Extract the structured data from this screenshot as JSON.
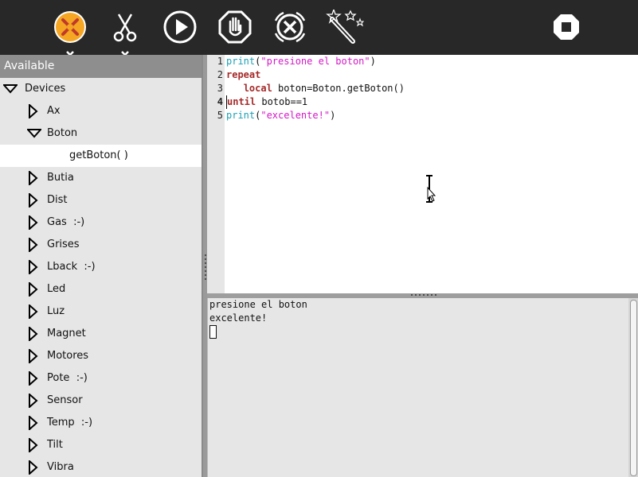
{
  "toolbar": {
    "buttons": [
      {
        "name": "activity-icon"
      },
      {
        "name": "scissors-icon"
      },
      {
        "name": "play-icon"
      },
      {
        "name": "stop-hand-icon"
      },
      {
        "name": "cancel-icon"
      },
      {
        "name": "magic-wand-icon"
      },
      {
        "name": "stop-icon"
      }
    ]
  },
  "sidebar": {
    "header": "Available",
    "items": [
      {
        "label": "Devices",
        "state": "expanded",
        "level": 0
      },
      {
        "label": "Ax",
        "state": "collapsed",
        "level": 1
      },
      {
        "label": "Boton",
        "state": "expanded",
        "level": 1
      },
      {
        "label": "getBoton( )",
        "state": "leaf",
        "level": 2,
        "selected": true
      },
      {
        "label": "Butia",
        "state": "collapsed",
        "level": 1
      },
      {
        "label": "Dist",
        "state": "collapsed",
        "level": 1
      },
      {
        "label": "Gas  :-)",
        "state": "collapsed",
        "level": 1
      },
      {
        "label": "Grises",
        "state": "collapsed",
        "level": 1
      },
      {
        "label": "Lback  :-)",
        "state": "collapsed",
        "level": 1
      },
      {
        "label": "Led",
        "state": "collapsed",
        "level": 1
      },
      {
        "label": "Luz",
        "state": "collapsed",
        "level": 1
      },
      {
        "label": "Magnet",
        "state": "collapsed",
        "level": 1
      },
      {
        "label": "Motores",
        "state": "collapsed",
        "level": 1
      },
      {
        "label": "Pote  :-)",
        "state": "collapsed",
        "level": 1
      },
      {
        "label": "Sensor",
        "state": "collapsed",
        "level": 1
      },
      {
        "label": "Temp  :-)",
        "state": "collapsed",
        "level": 1
      },
      {
        "label": "Tilt",
        "state": "collapsed",
        "level": 1
      },
      {
        "label": "Vibra",
        "state": "collapsed",
        "level": 1
      }
    ]
  },
  "editor": {
    "line_numbers": [
      "1",
      "2",
      "3",
      "4",
      "5"
    ],
    "lines": [
      [
        {
          "t": "print",
          "c": "fn"
        },
        {
          "t": "(",
          "c": "plain"
        },
        {
          "t": "\"presione el boton\"",
          "c": "str"
        },
        {
          "t": ")",
          "c": "plain"
        }
      ],
      [
        {
          "t": "repeat",
          "c": "kw"
        }
      ],
      [
        {
          "t": "   ",
          "c": "plain"
        },
        {
          "t": "local",
          "c": "kw"
        },
        {
          "t": " boton=Boton.getBoton()",
          "c": "plain"
        }
      ],
      [
        {
          "t": "until",
          "c": "kw"
        },
        {
          "t": " botob==1",
          "c": "plain"
        }
      ],
      [
        {
          "t": "print",
          "c": "fn"
        },
        {
          "t": "(",
          "c": "plain"
        },
        {
          "t": "\"excelente!\"",
          "c": "str"
        },
        {
          "t": ")",
          "c": "plain"
        }
      ]
    ]
  },
  "console": {
    "lines": [
      "presione el boton",
      "excelente!"
    ]
  },
  "colors": {
    "toolbar_bg": "#282828",
    "keyword": "#a52a2a",
    "function": "#1ea0b4",
    "string": "#d319c6",
    "activity_icon": "#f5a623"
  }
}
